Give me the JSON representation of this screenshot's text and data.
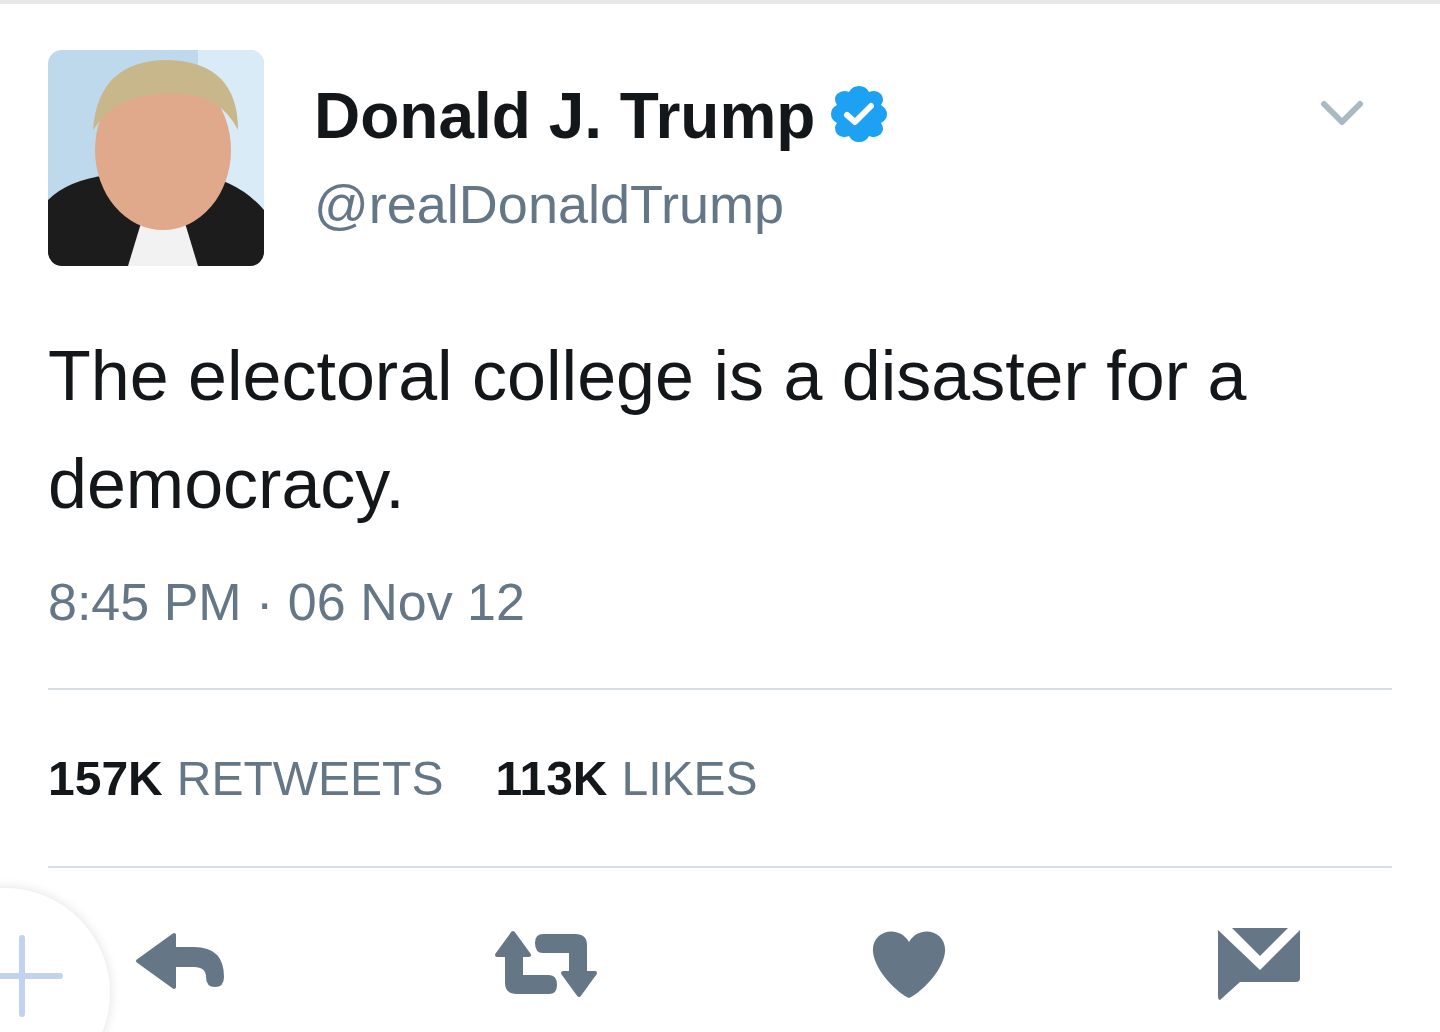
{
  "tweet": {
    "author": {
      "name": "Donald J. Trump",
      "verified": true,
      "handle": "@realDonaldTrump"
    },
    "text": "The electoral college is a disaster for a democracy.",
    "timestamp": "8:45 PM · 06 Nov 12",
    "stats": [
      {
        "count": "157K",
        "label": "RETWEETS"
      },
      {
        "count": "113K",
        "label": "LIKES"
      }
    ],
    "actions": [
      {
        "kind": "reply"
      },
      {
        "kind": "retweet"
      },
      {
        "kind": "like"
      },
      {
        "kind": "message"
      }
    ]
  },
  "compose_button": {
    "kind": "compose"
  }
}
